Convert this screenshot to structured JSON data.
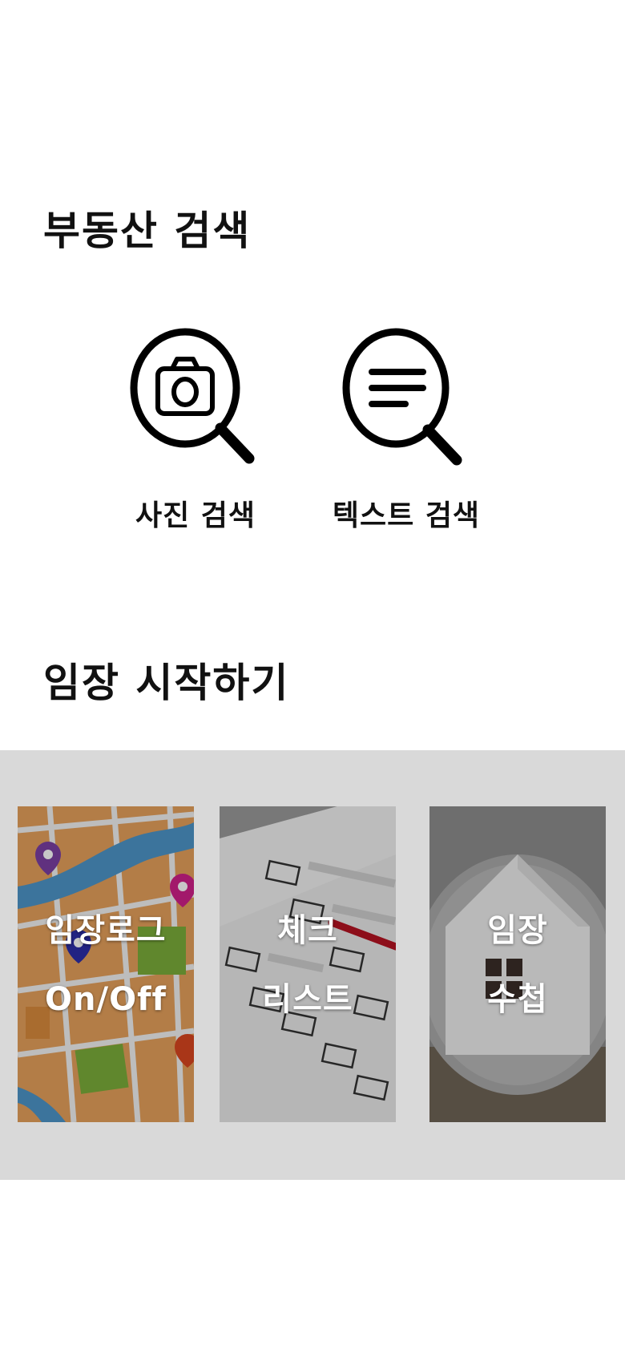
{
  "sections": {
    "search_title": "부동산 검색",
    "start_title": "임장 시작하기"
  },
  "search_options": {
    "photo": {
      "label": "사진 검색",
      "icon": "camera-search-icon"
    },
    "text": {
      "label": "텍스트 검색",
      "icon": "text-search-icon"
    }
  },
  "cards": {
    "log": {
      "line1": "임장로그",
      "line2": "On/Off",
      "image": "map-pins-image"
    },
    "checklist": {
      "line1": "체크",
      "line2": "리스트",
      "image": "checklist-paper-image"
    },
    "notebook": {
      "line1": "임장",
      "line2": "수첩",
      "image": "house-magnifier-image"
    }
  },
  "colors": {
    "band_background": "#d9d9d9",
    "text": "#111111"
  }
}
